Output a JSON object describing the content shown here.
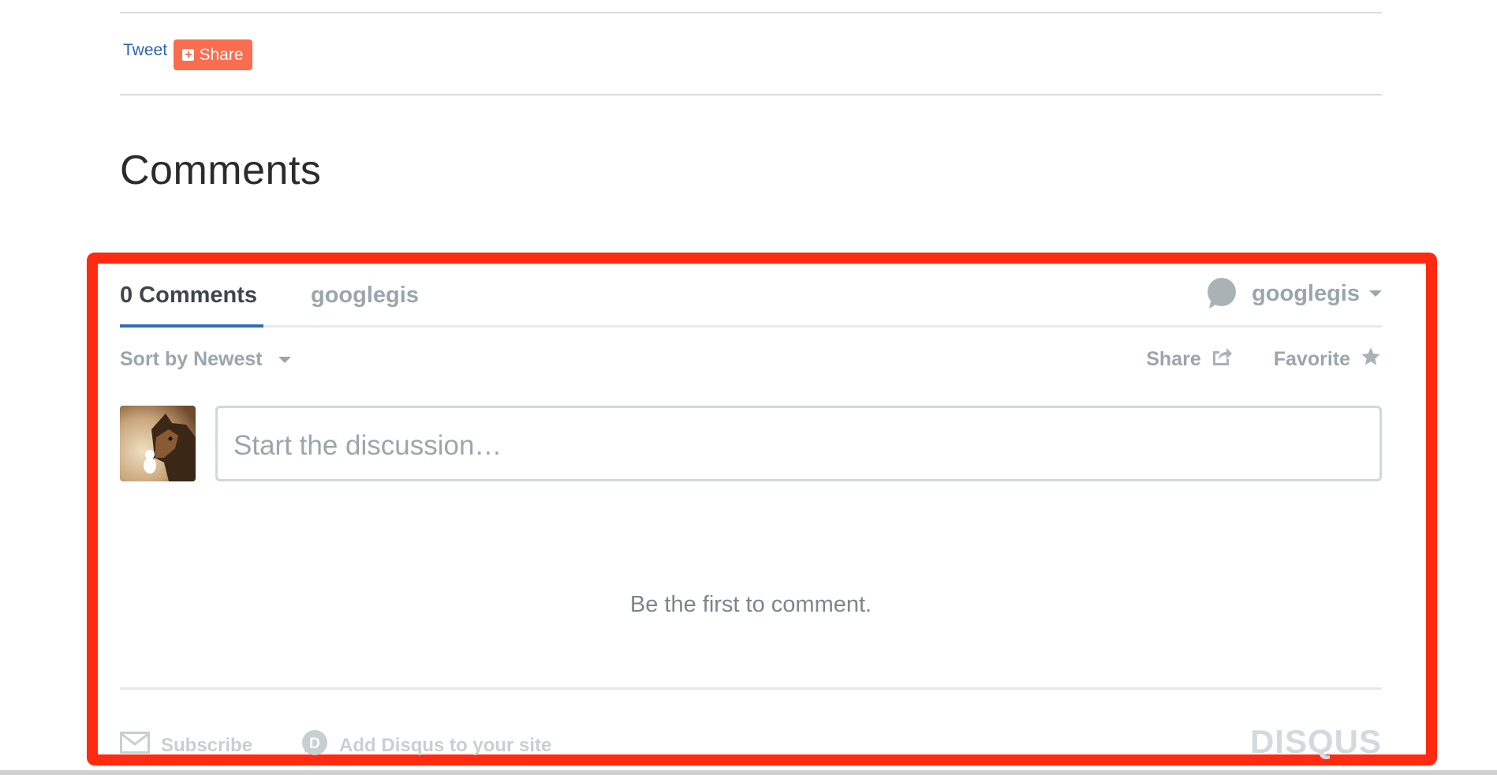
{
  "share_bar": {
    "tweet_label": "Tweet",
    "share_label": "Share"
  },
  "section": {
    "title": "Comments"
  },
  "disqus": {
    "tabs": {
      "comments_label": "0 Comments",
      "forum_label": "googlegis"
    },
    "user": {
      "name": "googlegis"
    },
    "sort_label": "Sort by Newest",
    "actions": {
      "share_label": "Share",
      "favorite_label": "Favorite"
    },
    "input": {
      "placeholder": "Start the discussion…"
    },
    "empty_message": "Be the first to comment.",
    "footer": {
      "subscribe_label": "Subscribe",
      "add_label": "Add Disqus to your site",
      "brand": "DISQUS"
    }
  },
  "colors": {
    "highlight_border": "#ff2a0f",
    "share_button": "#fa6d4f",
    "tab_active_underline": "#2e6fb4",
    "link": "#2a63b8"
  }
}
